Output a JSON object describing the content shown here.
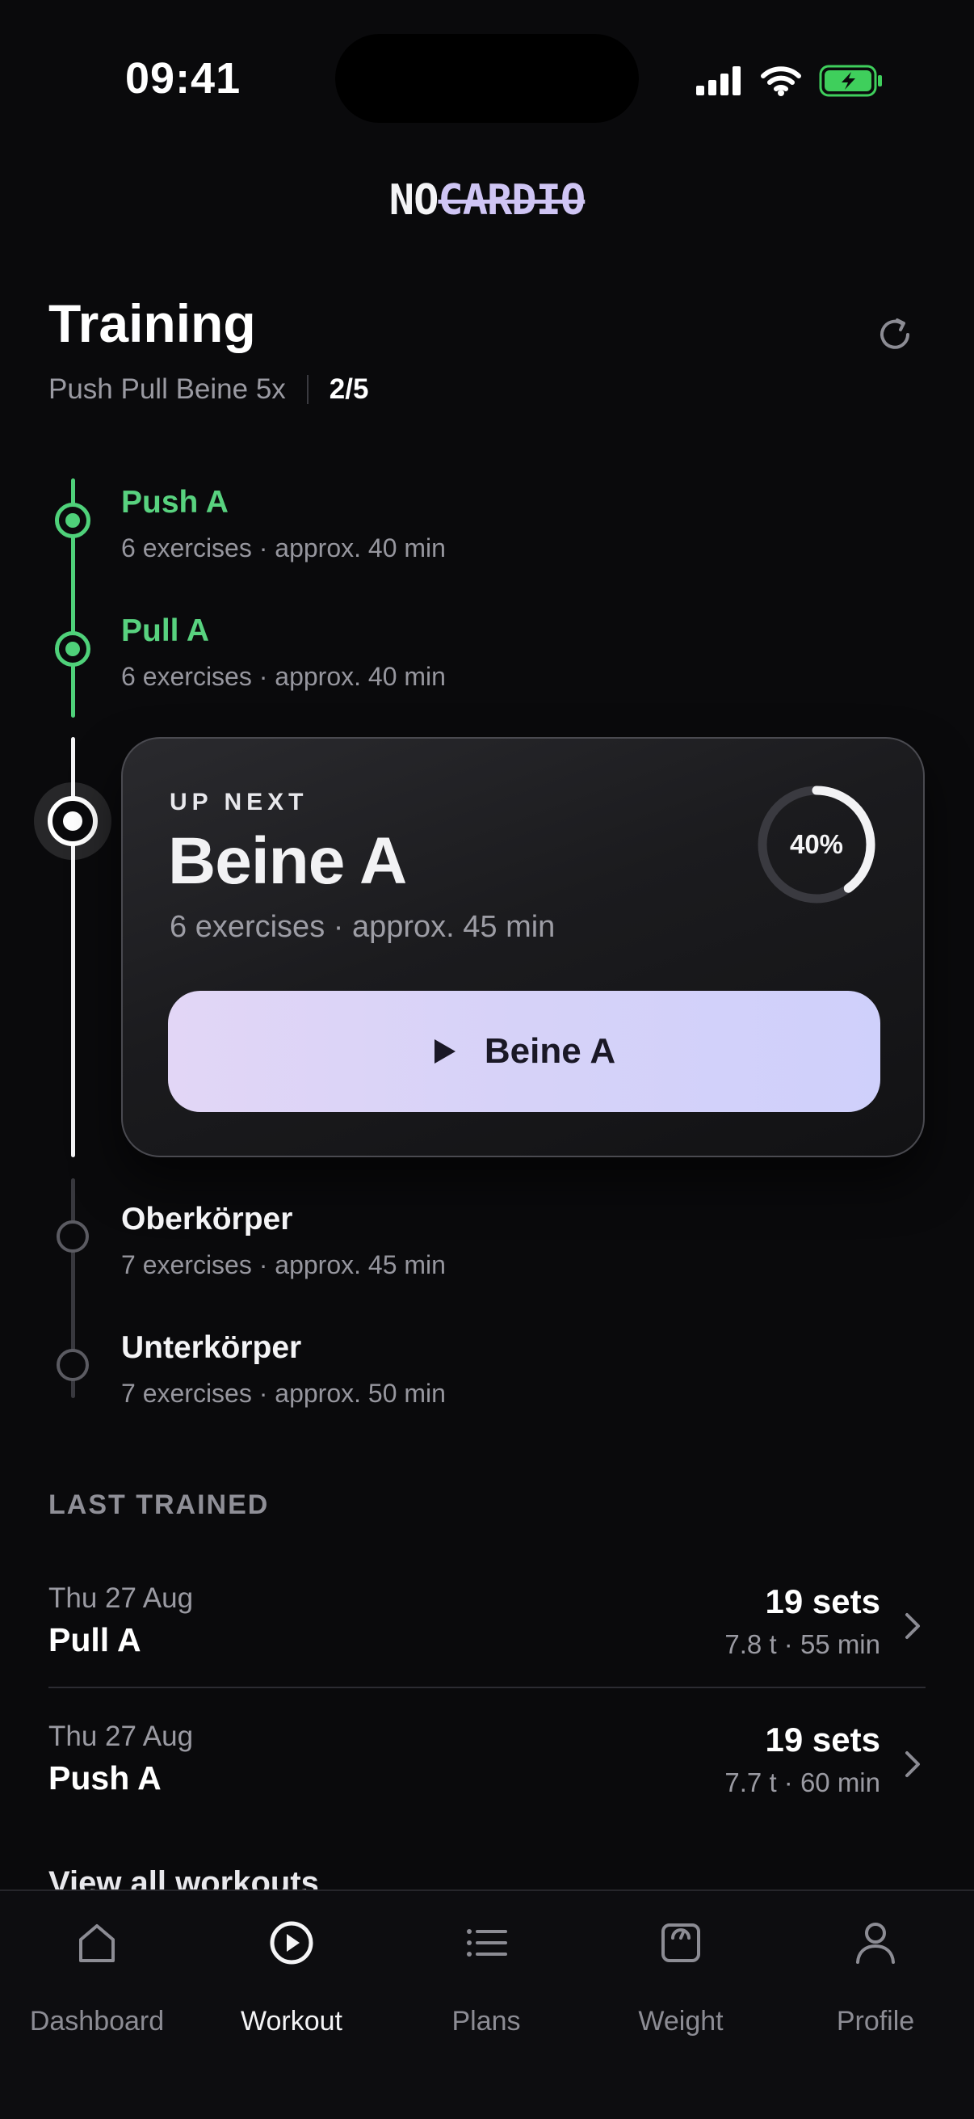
{
  "status_bar": {
    "time": "09:41"
  },
  "logo": {
    "prefix": "NO",
    "struck": "CARDIO"
  },
  "header": {
    "title": "Training",
    "plan_name": "Push Pull Beine 5x",
    "progress_count": "2/5"
  },
  "timeline": {
    "completed": [
      {
        "title": "Push A",
        "meta": "6 exercises · approx. 40 min"
      },
      {
        "title": "Pull A",
        "meta": "6 exercises · approx. 40 min"
      }
    ],
    "current": {
      "eyebrow": "UP NEXT",
      "title": "Beine A",
      "meta": "6 exercises · approx. 45 min",
      "progress_label": "40%",
      "progress_fraction": 0.4,
      "start_label": "Beine A"
    },
    "upcoming": [
      {
        "title": "Oberkörper",
        "meta": "7 exercises · approx. 45 min"
      },
      {
        "title": "Unterkörper",
        "meta": "7 exercises · approx. 50 min"
      }
    ]
  },
  "last_trained": {
    "label": "LAST TRAINED",
    "items": [
      {
        "date": "Thu 27 Aug",
        "name": "Pull A",
        "sets": "19 sets",
        "stats": "7.8 t · 55 min"
      },
      {
        "date": "Thu 27 Aug",
        "name": "Push A",
        "sets": "19 sets",
        "stats": "7.7 t · 60 min"
      }
    ],
    "view_all": "View all workouts"
  },
  "tabs": [
    {
      "label": "Dashboard",
      "icon": "home-icon"
    },
    {
      "label": "Workout",
      "icon": "play-circle-icon",
      "active": true
    },
    {
      "label": "Plans",
      "icon": "list-icon"
    },
    {
      "label": "Weight",
      "icon": "scale-icon"
    },
    {
      "label": "Profile",
      "icon": "person-icon"
    }
  ],
  "colors": {
    "background": "#0a0a0c",
    "completed_green": "#58d27f",
    "accent_lavender": "#d6d2f8",
    "battery_green": "#3fcf5c"
  }
}
